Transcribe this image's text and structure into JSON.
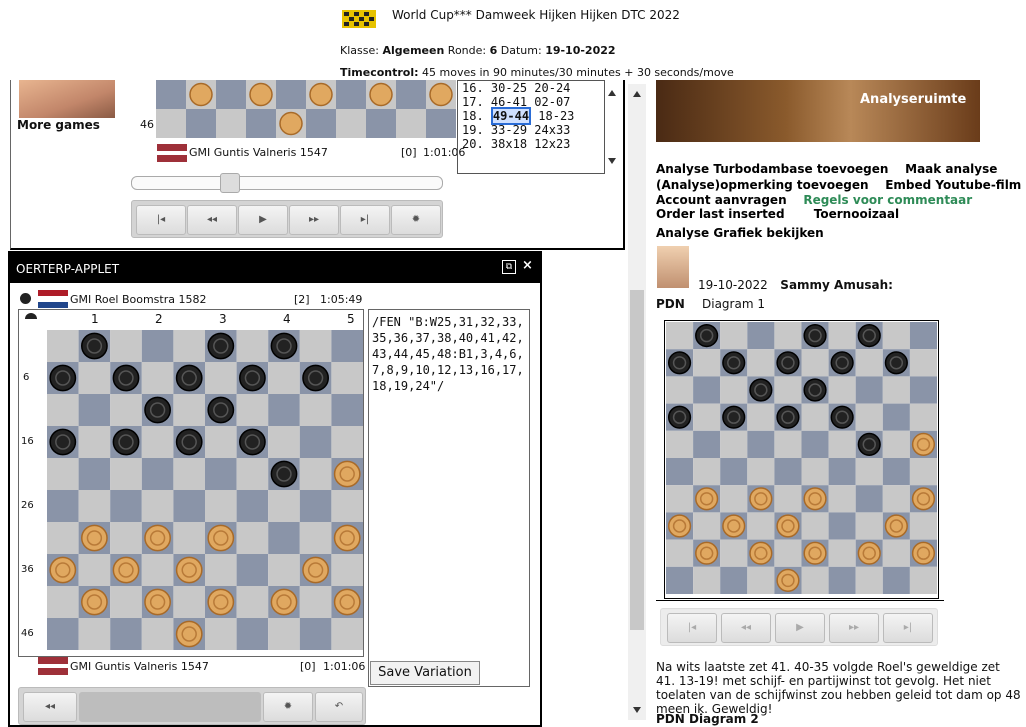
{
  "header": {
    "title": "World Cup*** Damweek Hijken Hijken DTC 2022",
    "klasse_label": "Klasse:",
    "klasse_value": "Algemeen",
    "ronde_label": "Ronde:",
    "ronde_value": "6",
    "datum_label": "Datum:",
    "datum_value": "19-10-2022",
    "timecontrol_label": "Timecontrol:",
    "timecontrol_value": "45 moves in 90 minutes/30 minutes + 30 seconds/move"
  },
  "top_panel": {
    "more_games": "More games",
    "row_label": "46",
    "player": {
      "name": "GMI Guntis Valneris 1547",
      "score": "[0]",
      "time": "1:01:06"
    },
    "moves": [
      {
        "num": "16.",
        "white": "30-25",
        "black": "20-24"
      },
      {
        "num": "17.",
        "white": "46-41",
        "black": "02-07"
      },
      {
        "num": "18.",
        "white": "49-44",
        "black": "18-23"
      },
      {
        "num": "19.",
        "white": "33-29",
        "black": "24x33"
      },
      {
        "num": "20.",
        "white": "38x18",
        "black": "12x23"
      }
    ]
  },
  "applet": {
    "title": "OERTERP-APPLET",
    "player_black": {
      "name": "GMI Roel Boomstra 1582",
      "score": "[2]",
      "time": "1:05:49"
    },
    "player_white": {
      "name": "GMI Guntis Valneris 1547",
      "score": "[0]",
      "time": "1:01:06"
    },
    "col_numbers": [
      "1",
      "2",
      "3",
      "4",
      "5"
    ],
    "row_numbers": [
      "6",
      "16",
      "26",
      "36",
      "46"
    ],
    "fen": "/FEN \"B:W25,31,32,33,35,36,37,38,40,41,42,43,44,45,48:B1,3,4,6,7,8,9,10,12,13,16,17,18,19,24\"/",
    "save_variation": "Save Variation"
  },
  "right": {
    "banner_text": "Analyseruimte",
    "links": {
      "l1a": "Analyse Turbodambase toevoegen",
      "l1b": "Maak analyse",
      "l2a": "(Analyse)opmerking toevoegen",
      "l2b": "Embed Youtube-film",
      "l3a": "Account aanvragen",
      "l3b": "Regels voor commentaar",
      "l4a": "Order last inserted",
      "l4b": "Toernooizaal",
      "l5": "Analyse Grafiek bekijken"
    },
    "post_date": "19-10-2022",
    "post_author": "Sammy Amusah:",
    "pdn_label": "PDN",
    "diagram_label": "Diagram 1",
    "comment": "Na wits laatste zet 41. 40-35 volgde Roel's geweldige zet 41. 13-19! met schijf- en partijwinst tot gevolg. Het niet toelaten van de schijfwinst zou hebben geleid tot dam op 48 meen ik. Geweldig!",
    "pdn2": "PDN    Diagram 2"
  },
  "colors": {
    "light_square": "#c8c8c8",
    "dark_square": "#8a94a8",
    "white_piece": "#e0a860",
    "black_piece": "#222222",
    "link_green": "#2e8b57"
  }
}
